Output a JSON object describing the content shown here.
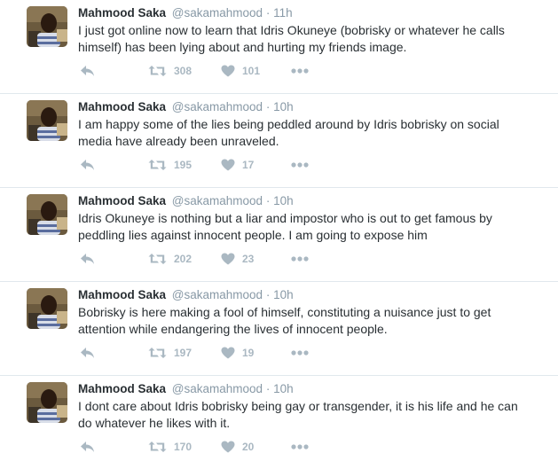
{
  "colors": {
    "name": "#292f33",
    "meta": "#8899a6",
    "action": "#aab8c2",
    "divider": "#e1e8ed"
  },
  "icons": {
    "reply": "reply-icon",
    "retweet": "retweet-icon",
    "like": "heart-icon",
    "more": "more-icon"
  },
  "tweets": [
    {
      "name": "Mahmood Saka",
      "handle": "@sakamahmood",
      "sep": "·",
      "time": "11h",
      "text": "I just got online now to learn that Idris Okuneye (bobrisky or whatever he calls\nhimself) has been lying about and hurting my friends image.",
      "retweets": "308",
      "likes": "101"
    },
    {
      "name": "Mahmood Saka",
      "handle": "@sakamahmood",
      "sep": "·",
      "time": "10h",
      "text": "I am happy some of the lies being peddled around by Idris bobrisky on social\nmedia have already been unraveled.",
      "retweets": "195",
      "likes": "17"
    },
    {
      "name": "Mahmood Saka",
      "handle": "@sakamahmood",
      "sep": "·",
      "time": "10h",
      "text": "Idris Okuneye is nothing but a liar and impostor who is out to get famous by\npeddling lies against innocent people. I am going to expose him",
      "retweets": "202",
      "likes": "23"
    },
    {
      "name": "Mahmood Saka",
      "handle": "@sakamahmood",
      "sep": "·",
      "time": "10h",
      "text": "Bobrisky is here making a fool of himself, constituting a nuisance just to get\nattention while endangering the lives of innocent people.",
      "retweets": "197",
      "likes": "19"
    },
    {
      "name": "Mahmood Saka",
      "handle": "@sakamahmood",
      "sep": "·",
      "time": "10h",
      "text": "I dont care about Idris bobrisky being gay or transgender, it is his life and he can\ndo whatever he likes with it.",
      "retweets": "170",
      "likes": "20"
    }
  ]
}
